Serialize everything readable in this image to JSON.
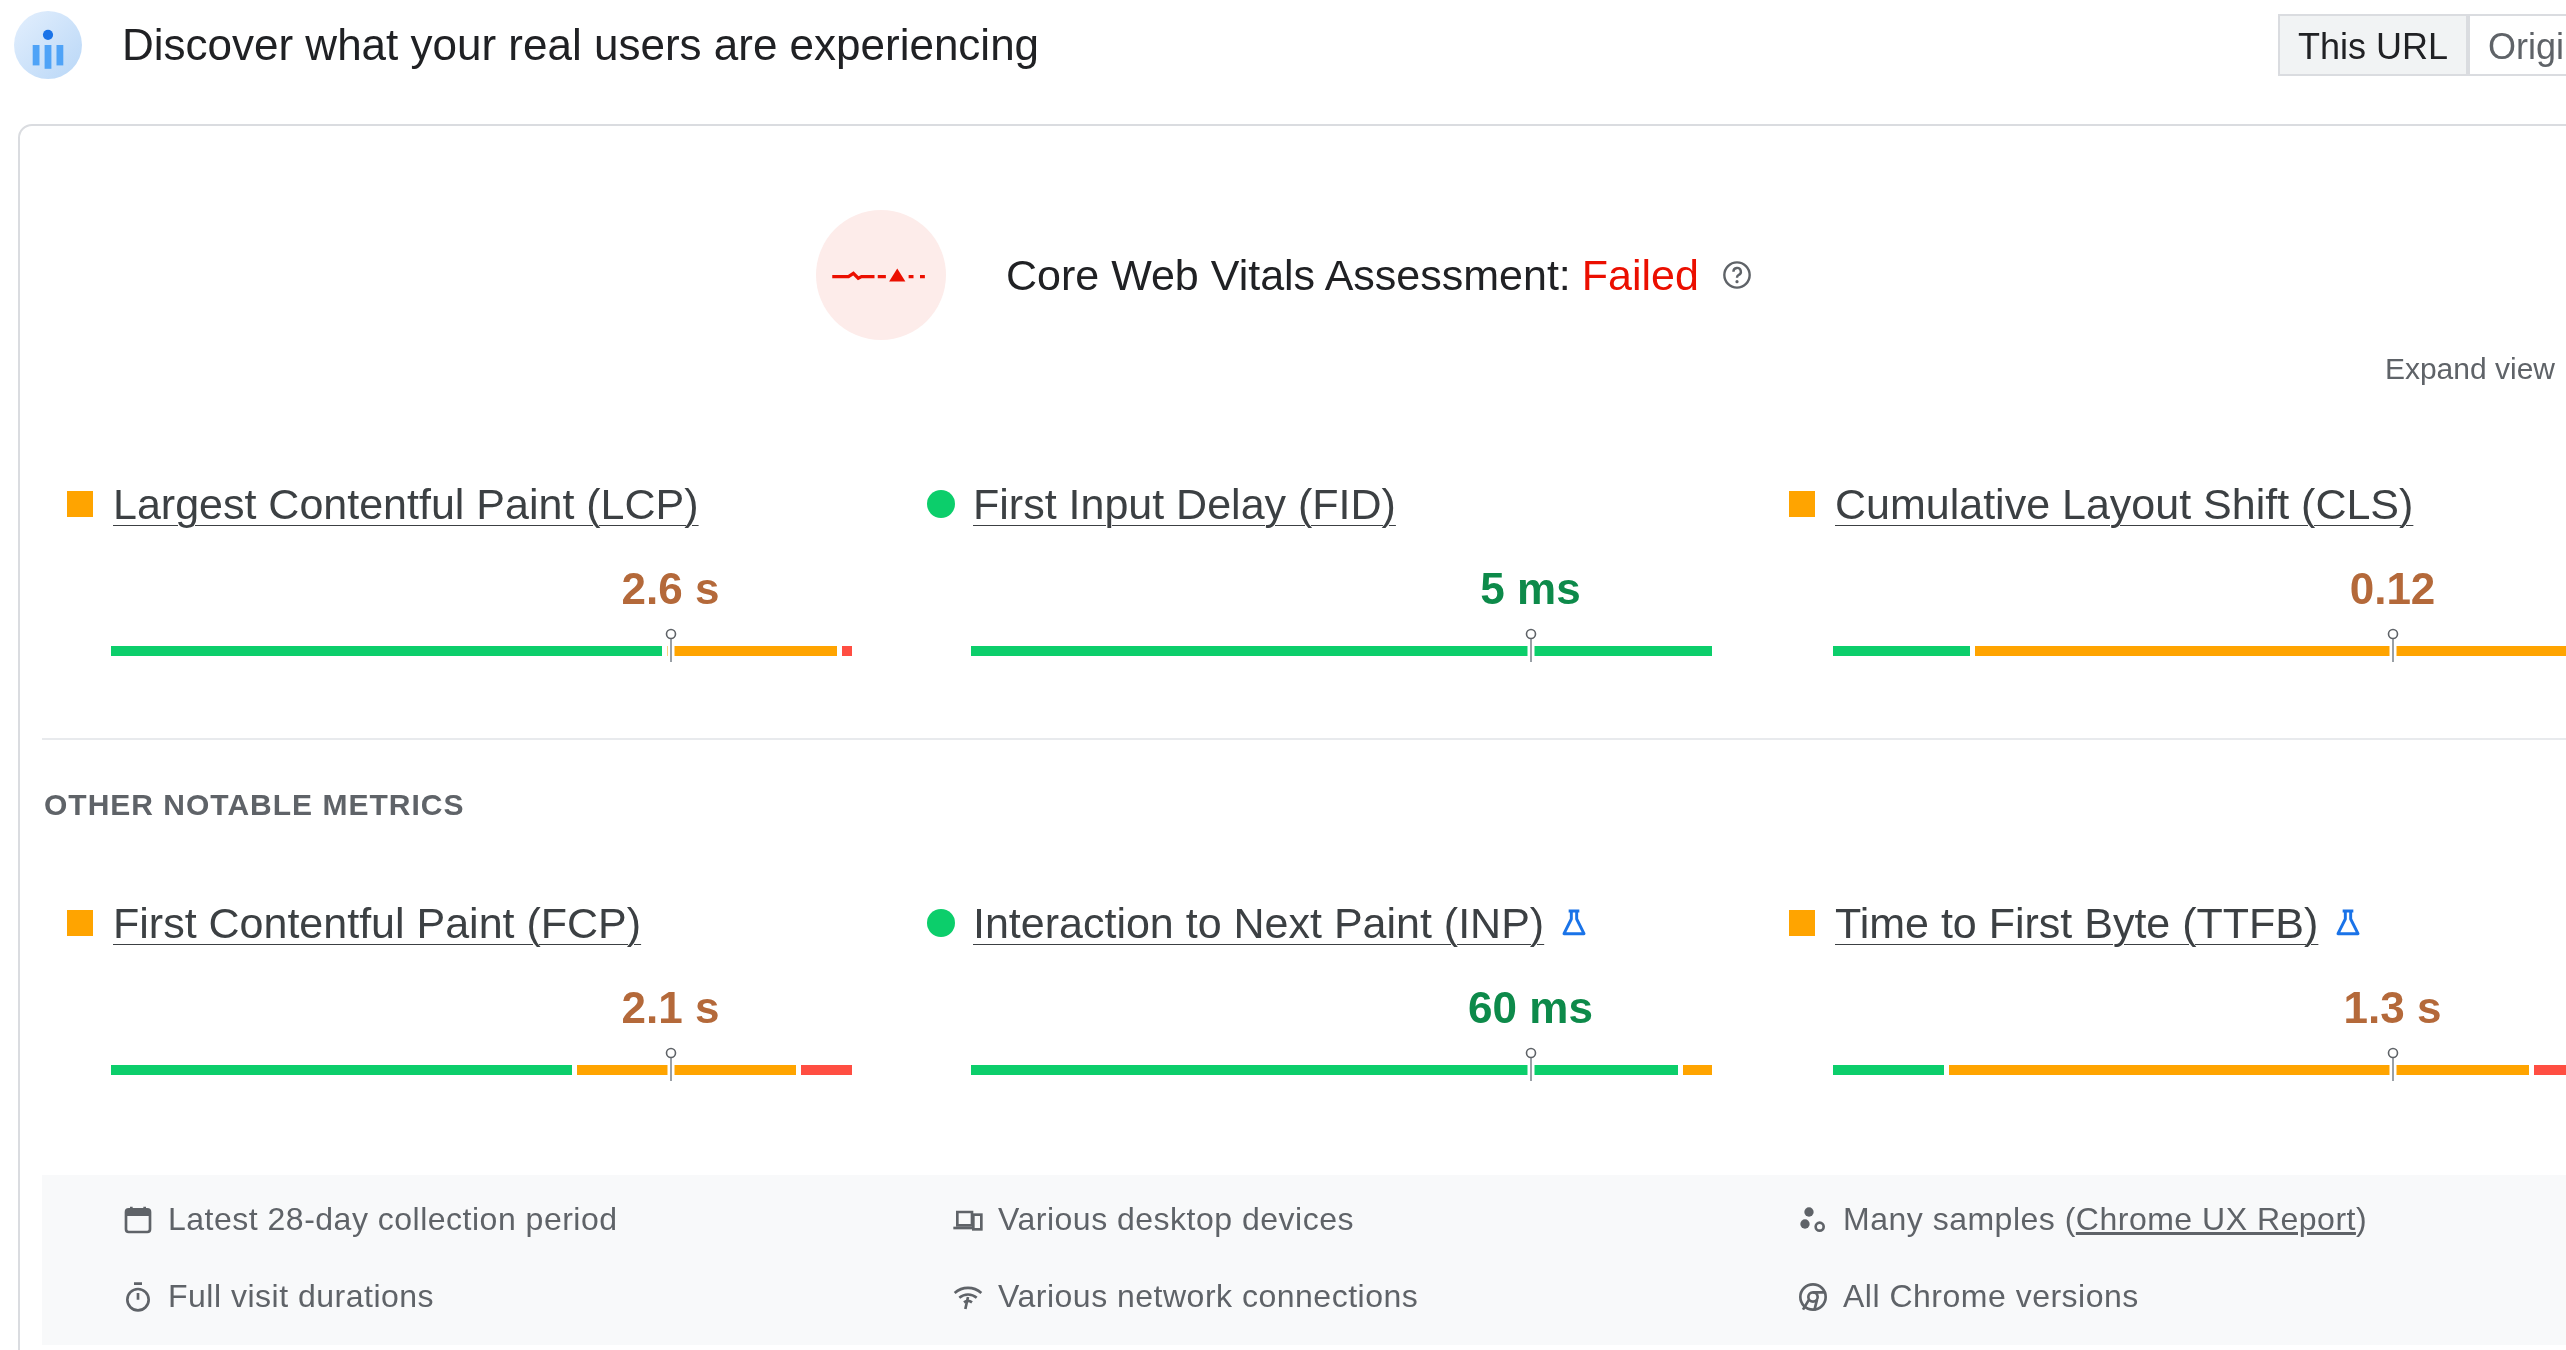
{
  "header": {
    "title": "Discover what your real users are experiencing"
  },
  "scope_toggle": [
    {
      "label": "This URL",
      "selected": true
    },
    {
      "label": "Origi",
      "selected": false
    }
  ],
  "assessment": {
    "label": "Core Web Vitals Assessment:",
    "result": "Failed"
  },
  "expand_link": "Expand view",
  "core_metrics": [
    {
      "name": "Largest Contentful Paint (LCP)",
      "kind": "square",
      "color": "#ffa400",
      "value": "2.6 s",
      "experimental": false
    },
    {
      "name": "First Input Delay (FID)",
      "kind": "dot",
      "color": "#0cce6b",
      "value": "5 ms",
      "experimental": false
    },
    {
      "name": "Cumulative Layout Shift (CLS)",
      "kind": "square",
      "color": "#ffa400",
      "value": "0.12",
      "experimental": false
    }
  ],
  "other_metrics_heading": "OTHER NOTABLE METRICS",
  "other_metrics": [
    {
      "name": "First Contentful Paint (FCP)",
      "kind": "square",
      "color": "#ffa400",
      "value": "2.1 s",
      "experimental": false
    },
    {
      "name": "Interaction to Next Paint (INP)",
      "kind": "dot",
      "color": "#0cce6b",
      "value": "60 ms",
      "experimental": true
    },
    {
      "name": "Time to First Byte (TTFB)",
      "kind": "square",
      "color": "#ffa400",
      "value": "1.3 s",
      "experimental": true
    }
  ],
  "footer_items": [
    {
      "kind": "calendar",
      "text": "Latest 28-day collection period"
    },
    {
      "kind": "devices",
      "text": "Various desktop devices"
    },
    {
      "kind": "samples",
      "text": "Many samples (",
      "link": "Chrome UX Report",
      "after": ")"
    },
    {
      "kind": "timer",
      "text": "Full visit durations"
    },
    {
      "kind": "network",
      "text": "Various network connections"
    },
    {
      "kind": "chrome",
      "text": "All Chrome versions"
    }
  ]
}
